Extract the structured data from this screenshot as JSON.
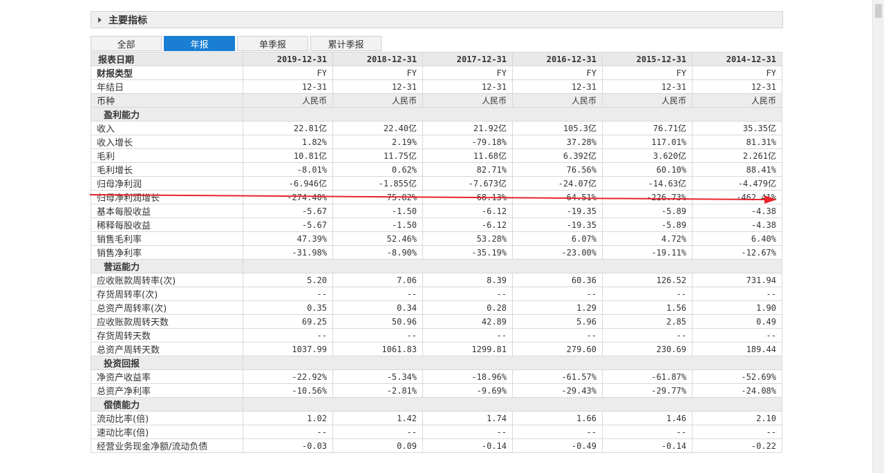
{
  "section": {
    "title": "主要指标"
  },
  "tabs": [
    {
      "label": "全部",
      "active": false
    },
    {
      "label": "年报",
      "active": true
    },
    {
      "label": "单季报",
      "active": false
    },
    {
      "label": "累计季报",
      "active": false
    }
  ],
  "table": {
    "header_label": "报表日期",
    "dates": [
      "2019-12-31",
      "2018-12-31",
      "2017-12-31",
      "2016-12-31",
      "2015-12-31",
      "2014-12-31"
    ],
    "rows": [
      {
        "kind": "data",
        "bold": true,
        "gray": false,
        "label": "财报类型",
        "values": [
          "FY",
          "FY",
          "FY",
          "FY",
          "FY",
          "FY"
        ]
      },
      {
        "kind": "data",
        "bold": false,
        "gray": false,
        "label": "年结日",
        "values": [
          "12-31",
          "12-31",
          "12-31",
          "12-31",
          "12-31",
          "12-31"
        ]
      },
      {
        "kind": "data",
        "bold": false,
        "gray": true,
        "label": "币种",
        "values": [
          "人民币",
          "人民币",
          "人民币",
          "人民币",
          "人民币",
          "人民币"
        ]
      },
      {
        "kind": "group",
        "label": "盈利能力"
      },
      {
        "kind": "data",
        "label": "收入",
        "values": [
          "22.81亿",
          "22.40亿",
          "21.92亿",
          "105.3亿",
          "76.71亿",
          "35.35亿"
        ]
      },
      {
        "kind": "data",
        "label": "收入增长",
        "values": [
          "1.82%",
          "2.19%",
          "-79.18%",
          "37.28%",
          "117.01%",
          "81.31%"
        ]
      },
      {
        "kind": "data",
        "label": "毛利",
        "values": [
          "10.81亿",
          "11.75亿",
          "11.68亿",
          "6.392亿",
          "3.620亿",
          "2.261亿"
        ]
      },
      {
        "kind": "data",
        "label": "毛利增长",
        "values": [
          "-8.01%",
          "0.62%",
          "82.71%",
          "76.56%",
          "60.10%",
          "88.41%"
        ]
      },
      {
        "kind": "data",
        "label": "归母净利润",
        "values": [
          "-6.946亿",
          "-1.855亿",
          "-7.673亿",
          "-24.07亿",
          "-14.63亿",
          "-4.479亿"
        ]
      },
      {
        "kind": "data",
        "label": "归母净利润增长",
        "values": [
          "-274.40%",
          "75.82%",
          "68.13%",
          "-64.51%",
          "-226.73%",
          "-462.41%"
        ]
      },
      {
        "kind": "data",
        "label": "基本每股收益",
        "values": [
          "-5.67",
          "-1.50",
          "-6.12",
          "-19.35",
          "-5.89",
          "-4.38"
        ]
      },
      {
        "kind": "data",
        "label": "稀释每股收益",
        "values": [
          "-5.67",
          "-1.50",
          "-6.12",
          "-19.35",
          "-5.89",
          "-4.38"
        ]
      },
      {
        "kind": "data",
        "label": "销售毛利率",
        "values": [
          "47.39%",
          "52.46%",
          "53.28%",
          "6.07%",
          "4.72%",
          "6.40%"
        ]
      },
      {
        "kind": "data",
        "label": "销售净利率",
        "values": [
          "-31.98%",
          "-8.90%",
          "-35.19%",
          "-23.00%",
          "-19.11%",
          "-12.67%"
        ]
      },
      {
        "kind": "group",
        "label": "营运能力"
      },
      {
        "kind": "data",
        "label": "应收账款周转率(次)",
        "values": [
          "5.20",
          "7.06",
          "8.39",
          "60.36",
          "126.52",
          "731.94"
        ]
      },
      {
        "kind": "data",
        "label": "存货周转率(次)",
        "values": [
          "--",
          "--",
          "--",
          "--",
          "--",
          "--"
        ]
      },
      {
        "kind": "data",
        "label": "总资产周转率(次)",
        "values": [
          "0.35",
          "0.34",
          "0.28",
          "1.29",
          "1.56",
          "1.90"
        ]
      },
      {
        "kind": "data",
        "label": "应收账款周转天数",
        "values": [
          "69.25",
          "50.96",
          "42.89",
          "5.96",
          "2.85",
          "0.49"
        ]
      },
      {
        "kind": "data",
        "label": "存货周转天数",
        "values": [
          "--",
          "--",
          "--",
          "--",
          "--",
          "--"
        ]
      },
      {
        "kind": "data",
        "label": "总资产周转天数",
        "values": [
          "1037.99",
          "1061.83",
          "1299.81",
          "279.60",
          "230.69",
          "189.44"
        ]
      },
      {
        "kind": "group",
        "label": "投资回报"
      },
      {
        "kind": "data",
        "label": "净资产收益率",
        "values": [
          "-22.92%",
          "-5.34%",
          "-18.96%",
          "-61.57%",
          "-61.87%",
          "-52.69%"
        ]
      },
      {
        "kind": "data",
        "label": "总资产净利率",
        "values": [
          "-10.56%",
          "-2.81%",
          "-9.69%",
          "-29.43%",
          "-29.77%",
          "-24.08%"
        ]
      },
      {
        "kind": "group",
        "label": "偿债能力"
      },
      {
        "kind": "data",
        "label": "流动比率(倍)",
        "values": [
          "1.02",
          "1.42",
          "1.74",
          "1.66",
          "1.46",
          "2.10"
        ]
      },
      {
        "kind": "data",
        "label": "速动比率(倍)",
        "values": [
          "--",
          "--",
          "--",
          "--",
          "--",
          "--"
        ]
      },
      {
        "kind": "data",
        "label": "经营业务现金净额/流动负债",
        "values": [
          "-0.03",
          "0.09",
          "-0.14",
          "-0.49",
          "-0.14",
          "-0.22"
        ]
      }
    ]
  },
  "colors": {
    "accent": "#1a7fd4",
    "annotation": "#e8232a",
    "header_bg": "#e9e9e9",
    "group_bg": "#ececec"
  },
  "annotation": {
    "type": "arrow",
    "icon": "red-arrow"
  }
}
